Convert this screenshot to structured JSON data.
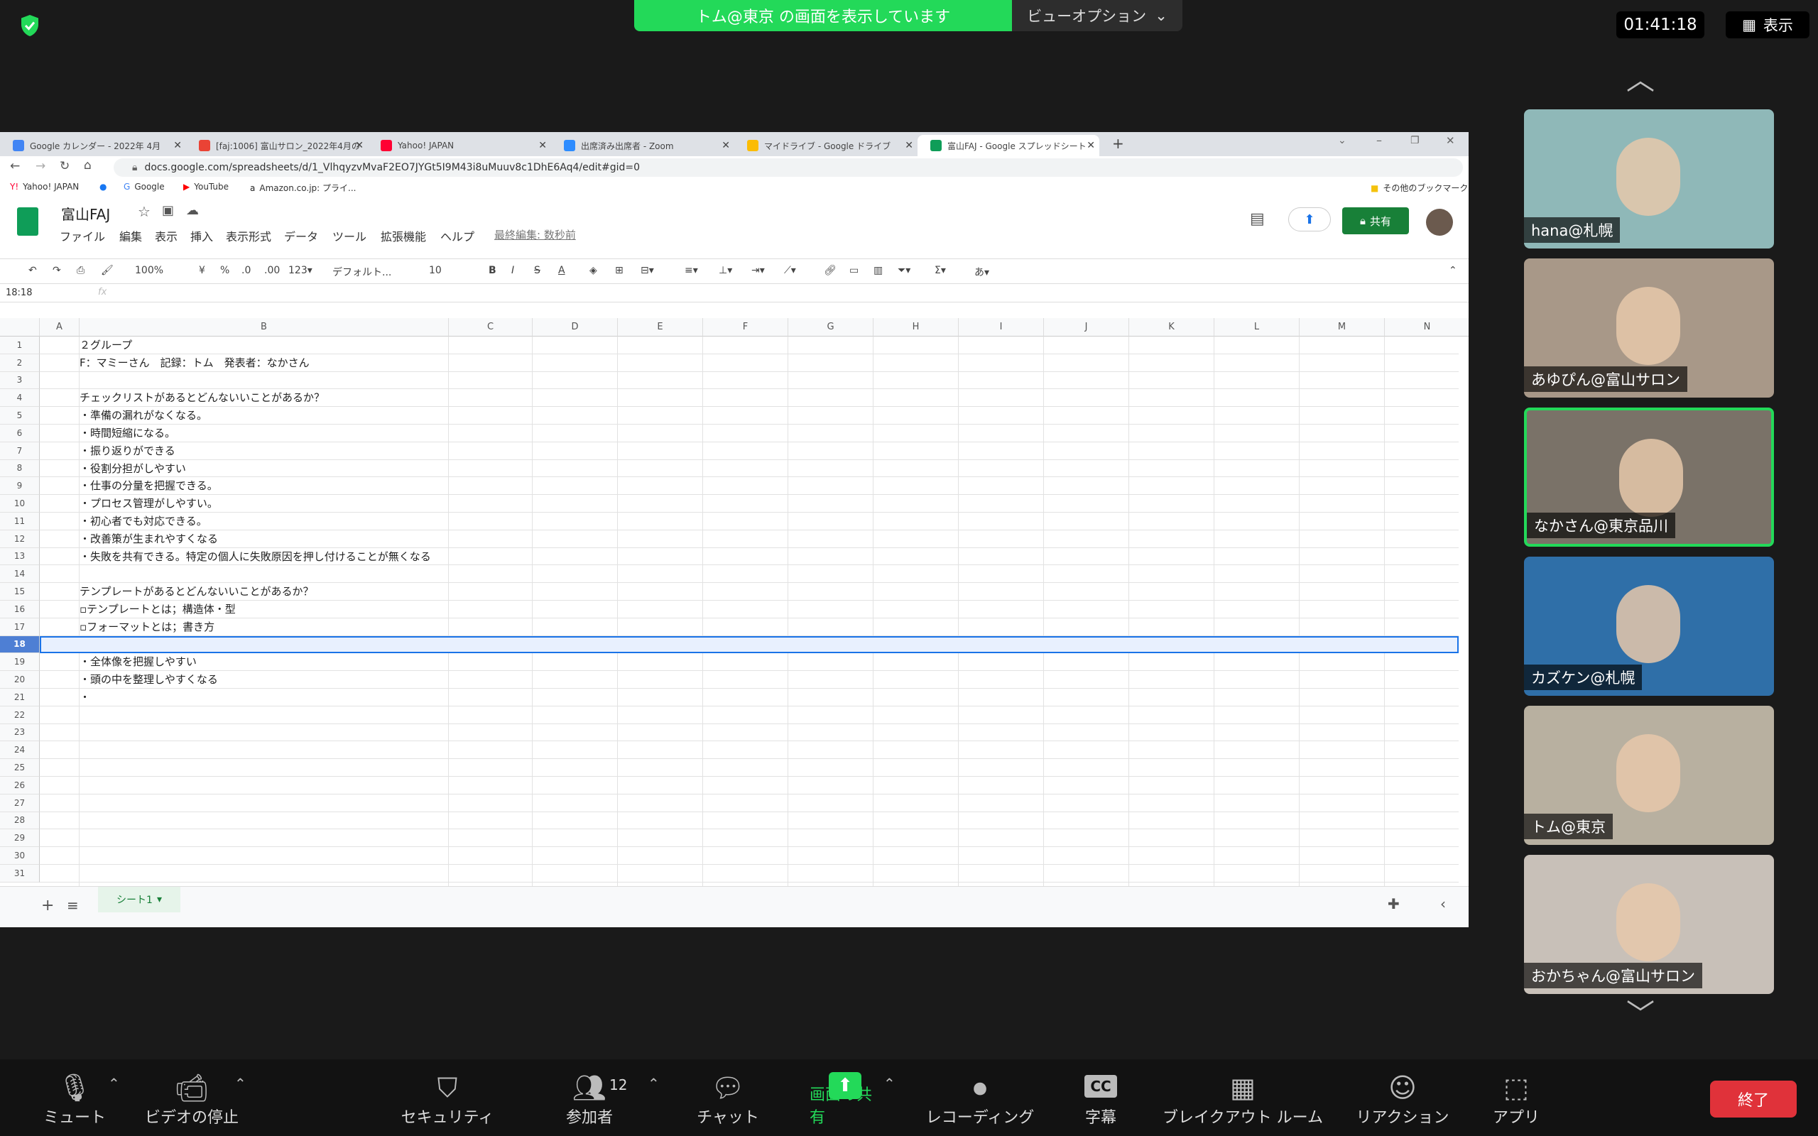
{
  "zoom": {
    "share_banner": "トム@東京 の画面を表示しています",
    "view_options": "ビューオプション",
    "clock": "01:41:18",
    "display_label": "表示",
    "end_label": "終了",
    "participant_count": "12",
    "controls": [
      {
        "label": "ミュート",
        "icon": "microphone-icon"
      },
      {
        "label": "ビデオの停止",
        "icon": "video-camera-icon"
      },
      {
        "label": "セキュリティ",
        "icon": "shield-icon"
      },
      {
        "label": "参加者",
        "icon": "participants-icon"
      },
      {
        "label": "チャット",
        "icon": "chat-icon"
      },
      {
        "label": "画面の共有",
        "icon": "share-screen-icon"
      },
      {
        "label": "レコーディング",
        "icon": "record-icon"
      },
      {
        "label": "字幕",
        "icon": "cc-icon"
      },
      {
        "label": "ブレイクアウト ルーム",
        "icon": "breakout-icon"
      },
      {
        "label": "リアクション",
        "icon": "reaction-icon"
      },
      {
        "label": "アプリ",
        "icon": "apps-icon"
      }
    ],
    "participants": [
      {
        "name": "hana@札幌",
        "active": false
      },
      {
        "name": "あゆぴん@富山サロン",
        "active": false
      },
      {
        "name": "なかさん@東京品川",
        "active": true
      },
      {
        "name": "カズケン@札幌",
        "active": false
      },
      {
        "name": "トム@東京",
        "active": false
      },
      {
        "name": "おかちゃん@富山サロン",
        "active": false
      }
    ]
  },
  "browser": {
    "tabs": [
      "Google カレンダー - 2022年 4月",
      "[faj:1006] 富山サロン_2022年4月の",
      "Yahoo! JAPAN",
      "出席済み出席者 - Zoom",
      "マイドライブ - Google ドライブ",
      "富山FAJ - Google スプレッドシート"
    ],
    "url": "docs.google.com/spreadsheets/d/1_VlhqyzvMvaF2EO7JYGt5I9M43i8uMuuv8c1DhE6Aq4/edit#gid=0",
    "bookmarks": [
      "Yahoo! JAPAN",
      "Google",
      "YouTube",
      "Amazon.co.jp: プライ...",
      "その他のブックマーク"
    ]
  },
  "sheets": {
    "doc_name": "富山FAJ",
    "menu": [
      "ファイル",
      "編集",
      "表示",
      "挿入",
      "表示形式",
      "データ",
      "ツール",
      "拡張機能",
      "ヘルプ"
    ],
    "last_edit": "最終編集: 数秒前",
    "share_label": "共有",
    "zoom": "100%",
    "font": "デフォルト...",
    "font_size": "10",
    "cell_ref": "18:18",
    "fx": "fx",
    "sheet_tab": "シート1",
    "columns": [
      "A",
      "B",
      "C",
      "D",
      "E",
      "F",
      "G",
      "H",
      "I",
      "J",
      "K",
      "L",
      "M",
      "N"
    ],
    "rows": [
      "２グループ",
      "F：マミーさん　記録：トム　発表者：なかさん",
      "",
      "チェックリストがあるとどんないいことがあるか？",
      "・準備の漏れがなくなる。",
      "・時間短縮になる。",
      "・振り返りができる",
      "・役割分担がしやすい",
      "・仕事の分量を把握できる。",
      "・プロセス管理がしやすい。",
      "・初心者でも対応できる。",
      "・改善策が生まれやすくなる",
      "・失敗を共有できる。特定の個人に失敗原因を押し付けることが無くなる",
      "",
      "テンプレートがあるとどんないいことがあるか？",
      "▫テンプレートとは；構造体・型",
      "▫フォーマットとは；書き方",
      "",
      "・全体像を把握しやすい",
      "・頭の中を整理しやすくなる",
      "・",
      "",
      "",
      "",
      "",
      "",
      "",
      "",
      "",
      "",
      ""
    ]
  }
}
